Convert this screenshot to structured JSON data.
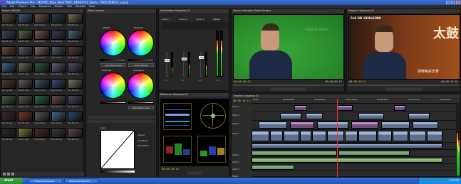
{
  "window": {
    "title": "Adobe Premiere Pro - 4K2000_Blue_Post(TWO)_DRM(0)V2_Demo_TWO(DRM)V2.prproj",
    "controls": [
      "minimize",
      "maximize",
      "close"
    ]
  },
  "menu": [
    "File",
    "Edit",
    "Project",
    "Clip",
    "Sequence",
    "Marker",
    "Title",
    "Window",
    "Help"
  ],
  "project_panel": {
    "title": "Project: 4K2000",
    "icon": "folder-icon",
    "thumbnails": [
      {
        "label": "Clip 01.mov",
        "color": "#5a4a3a"
      },
      {
        "label": "Clip 02.mov",
        "color": "#3a5a7a"
      },
      {
        "label": "Clip 03.mov",
        "color": "#6a5040"
      },
      {
        "label": "Clip 04.mov",
        "color": "#2a3a4a"
      },
      {
        "label": "Clip 05.mov",
        "color": "#7a6a50"
      },
      {
        "label": "Clip 06.mov",
        "color": "#3a4a5a"
      },
      {
        "label": "Clip 07.mov",
        "color": "#5a6a4a"
      },
      {
        "label": "Clip 08.mov",
        "color": "#7a5a4a"
      },
      {
        "label": "Clip 09.mov",
        "color": "#3a3a5a"
      },
      {
        "label": "Clip 10.mov",
        "color": "#4a6a7a"
      },
      {
        "label": "Clip 11.mov",
        "color": "#6a4a3a"
      },
      {
        "label": "Clip 12.mov",
        "color": "#5a5a6a"
      },
      {
        "label": "Clip 13.mov",
        "color": "#7a6a5a"
      },
      {
        "label": "Clip 14.mov",
        "color": "#4a5a6a"
      },
      {
        "label": "Clip 15.mov",
        "color": "#5a3a3a"
      },
      {
        "label": "Clip 16.mov",
        "color": "#3a6a8a"
      },
      {
        "label": "Clip 17.mov",
        "color": "#6a6a5a"
      },
      {
        "label": "Clip 18.mov",
        "color": "#2a5a3a"
      },
      {
        "label": "Clip 19.mov",
        "color": "#6a5a7a"
      },
      {
        "label": "Clip 20.mov",
        "color": "#5a4a6a"
      },
      {
        "label": "Clip 21.mov",
        "color": "#4a3a2a"
      },
      {
        "label": "Clip 22.mov",
        "color": "#6a5a5a"
      },
      {
        "label": "Clip 23.mov",
        "color": "#3a5a5a"
      },
      {
        "label": "Clip 24.mov",
        "color": "#3a4a7a"
      },
      {
        "label": "Clip 25.mov",
        "color": "#7a7a6a"
      },
      {
        "label": "Clip 26.mov",
        "color": "#4a5a4a"
      },
      {
        "label": "Clip 27.mov",
        "color": "#5a5a4a"
      },
      {
        "label": "Clip 28.mov",
        "color": "#2a6a3a"
      },
      {
        "label": "Clip 29.mov",
        "color": "#6a4a4a"
      },
      {
        "label": "Clip 30.mov",
        "color": "#4a4a5a"
      },
      {
        "label": "Clip 31.mov",
        "color": "#3a2a2a"
      },
      {
        "label": "Clip 32.mov",
        "color": "#7a3a2a"
      },
      {
        "label": "Clip 33.mov",
        "color": "#5a5a5a"
      },
      {
        "label": "Clip 34.mov",
        "color": "#4a6a8a"
      },
      {
        "label": "Clip 35.mov",
        "color": "#2a4a6a"
      },
      {
        "label": "Clip 36.mov",
        "color": "#2a2a2a"
      },
      {
        "label": "Clip 37.mov",
        "color": "#8a7a3a"
      },
      {
        "label": "Clip 38.mov",
        "color": "#4a2a2a"
      },
      {
        "label": "Clip 39.mov",
        "color": "#3a3a3a"
      },
      {
        "label": "Clip 40.mov",
        "color": "#5a4a4a"
      }
    ]
  },
  "effect_controls": {
    "title": "Effect Controls",
    "wheels": [
      {
        "label": "Master"
      },
      {
        "label": "Shadows"
      },
      {
        "label": "Midtones"
      },
      {
        "label": "Highlights"
      }
    ],
    "buttons": [
      "Auto Black Level",
      "Auto Contrast",
      "Auto White Level"
    ],
    "curves_labels": [
      "Input",
      "Output",
      "Auto Black",
      "Auto White"
    ]
  },
  "audio_mixer": {
    "title": "Audio Mixer: Sequence 01",
    "channels": [
      {
        "name": "Audio 1",
        "value": "0.0",
        "level": 0.35
      },
      {
        "name": "Audio 2",
        "value": "0.0",
        "level": 0.5
      },
      {
        "name": "Audio 3",
        "value": "0.0",
        "level": 0.45
      },
      {
        "name": "Master",
        "value": "0.0",
        "level": 0.8
      }
    ]
  },
  "reference_monitor": {
    "title": "Reference: Sequence 01",
    "timecode": "00:00:10:13",
    "scope_labels": [
      "YC Waveform",
      "Vectorscope",
      "RGB Parade",
      "YCbCr Parade"
    ]
  },
  "source_monitor": {
    "title": "Source: Interview (Green Screen)",
    "timecode_left": "00:00:04:22",
    "timecode_right": "00:00:09:13",
    "watermark": "OVERLAY DEMO"
  },
  "program_monitor": {
    "title": "Program: Sequence 01",
    "badge": "Full HD 1920x1080",
    "subtitle": "即時色彩去背",
    "title_text": "太鼓",
    "timecode_left": "00:00:10:13",
    "timecode_right": "00:00:16:22"
  },
  "timeline": {
    "title": "Timeline: Sequence 01",
    "timecode": "00:00:10:13",
    "ruler_marks": [
      "00:00",
      "00:00:04:00",
      "00:00:08:00",
      "00:00:12:00",
      "00:00:16:00",
      "00:00:20:00",
      "00:00:24:00"
    ],
    "tracks": [
      "Video 4",
      "Video 3",
      "Video 2",
      "Video 1",
      "Audio 1",
      "Audio 2",
      "Audio 3",
      "Master"
    ]
  },
  "taskbar": {
    "start": "start",
    "tasks": [
      "3 Windows Explorer",
      "Adobe Premiere Pro"
    ],
    "clock": "3:25 PM"
  }
}
